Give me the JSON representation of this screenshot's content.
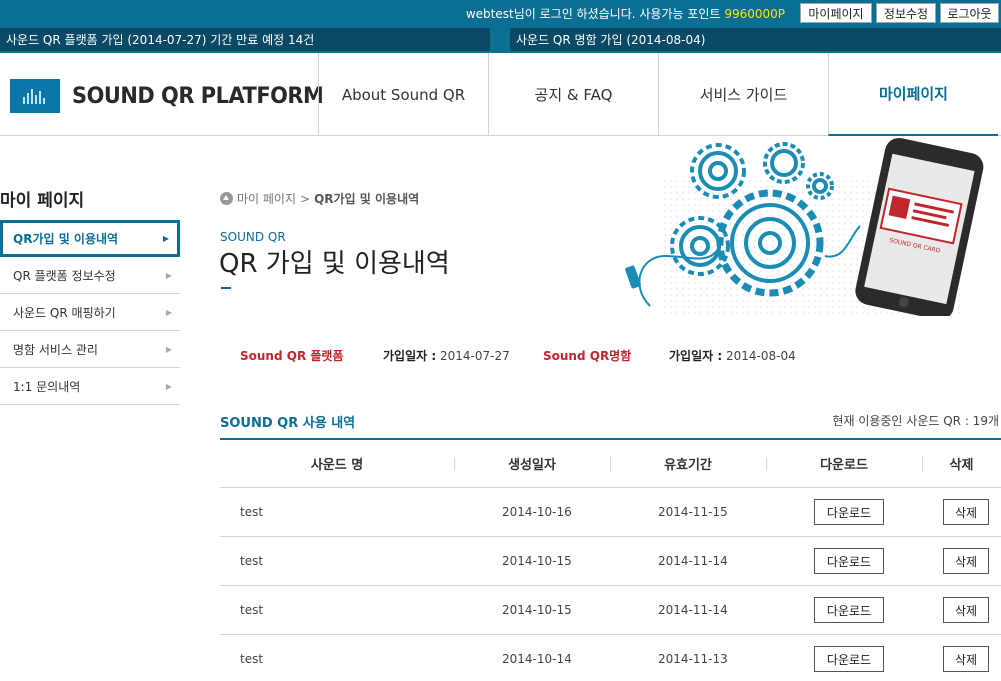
{
  "topbar": {
    "user": "webtest",
    "welcome_msg": "님이 로그인 하셨습니다. 사용가능 포인트",
    "points": "9960000P",
    "mypage_btn": "마이페이지",
    "edit_btn": "정보수정",
    "logout_btn": "로그아웃"
  },
  "notices": [
    "사운드 QR 플랫폼 가입 (2014-07-27) 기간 만료 예정 14건",
    "사운드 QR 명함 가입 (2014-08-04)"
  ],
  "logo": {
    "text": "SOUND QR PLATFORM"
  },
  "nav": [
    {
      "label": "About Sound QR"
    },
    {
      "label": "공지 & FAQ"
    },
    {
      "label": "서비스 가이드"
    },
    {
      "label": "마이페이지"
    }
  ],
  "sidebar": {
    "title": "마이 페이지",
    "items": [
      {
        "label": "QR가입 및 이용내역"
      },
      {
        "label": "QR 플랫폼 정보수정"
      },
      {
        "label": "사운드 QR 매핑하기"
      },
      {
        "label": "명함 서비스 관리"
      },
      {
        "label": "1:1 문의내역"
      }
    ]
  },
  "breadcrumb": {
    "root": "마이 페이지",
    "sep": ">",
    "current": "QR가입 및 이용내역"
  },
  "page": {
    "subtitle": "SOUND QR",
    "title": "QR 가입 및 이용내역"
  },
  "hero": {
    "card_text": "SOUND QR CARD"
  },
  "join": {
    "platform_label": "Sound QR 플랫폼",
    "platform_date_label": "가입일자 :",
    "platform_date": "2014-07-27",
    "card_label": "Sound QR명함",
    "card_date_label": "가입일자 :",
    "card_date": "2014-08-04"
  },
  "usage": {
    "title": "SOUND QR 사용 내역",
    "count_text": "현재 이용중인 사운드 QR : 19개",
    "columns": [
      "사운드 명",
      "생성일자",
      "유효기간",
      "다운로드",
      "삭제"
    ],
    "rows": [
      {
        "name": "test",
        "created": "2014-10-16",
        "expires": "2014-11-15",
        "download": "다운로드",
        "delete": "삭제"
      },
      {
        "name": "test",
        "created": "2014-10-15",
        "expires": "2014-11-14",
        "download": "다운로드",
        "delete": "삭제"
      },
      {
        "name": "test",
        "created": "2014-10-15",
        "expires": "2014-11-14",
        "download": "다운로드",
        "delete": "삭제"
      },
      {
        "name": "test",
        "created": "2014-10-14",
        "expires": "2014-11-13",
        "download": "다운로드",
        "delete": "삭제"
      }
    ]
  },
  "colors": {
    "brand": "#0b6e93",
    "notice_bg": "#0a4a66",
    "points": "#ffe600",
    "accent_red": "#c0272d"
  }
}
